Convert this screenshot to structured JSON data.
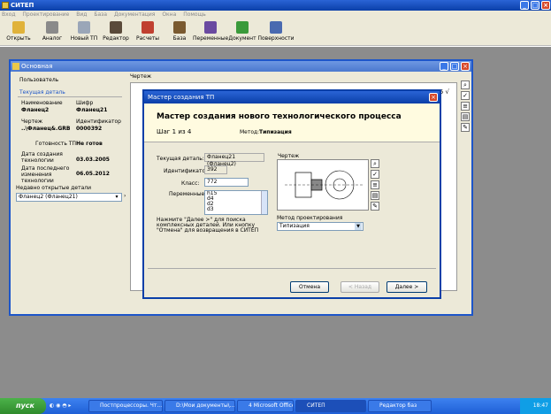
{
  "app": {
    "title": "СИТЕП"
  },
  "menu": [
    "Вход",
    "Проектирование",
    "Вид",
    "База",
    "Документация",
    "Окна",
    "Помощь"
  ],
  "toolbar": [
    {
      "label": "Открыть",
      "icon": "folder-open-icon",
      "color": "#e0b23a"
    },
    {
      "label": "Аналог",
      "icon": "hammer-icon",
      "color": "#8a8a8a"
    },
    {
      "label": "Новый ТП",
      "icon": "new-process-icon",
      "color": "#9aa6b8"
    },
    {
      "label": "Редактор",
      "icon": "editor-icon",
      "color": "#5a4a3a"
    },
    {
      "label": "Расчеты",
      "icon": "calculator-icon",
      "color": "#c04030"
    },
    {
      "label": "База",
      "icon": "database-icon",
      "color": "#7a5a30"
    },
    {
      "label": "Переменные",
      "icon": "function-icon",
      "color": "#6a4aa0"
    },
    {
      "label": "Документ",
      "icon": "document-icon",
      "color": "#3a9a3a"
    },
    {
      "label": "Поверхности",
      "icon": "surfaces-icon",
      "color": "#4a6ab0"
    }
  ],
  "main_window": {
    "title": "Основная",
    "user_label": "Пользователь",
    "current_part_header": "Текущая деталь",
    "name_label": "Наименование",
    "name_value": "Фланец2",
    "cipher_label": "Шифр",
    "cipher_value": "Фланец21",
    "drawing_label": "Чертеж",
    "drawing_value": "..\\Фланец&.GRB",
    "id_label": "Идентификатор",
    "id_value": "0000392",
    "readiness_label": "Готовность ТП",
    "readiness_value": "Не готов",
    "created_label": "Дата создания технологии",
    "created_value": "03.03.2005",
    "modified_label": "Дата последнего изменения технологии",
    "modified_value": "06.05.2012",
    "recent_label": "Недавно открытые детали",
    "recent_value": "Фланец2 (Фланец21)",
    "canvas_label": "Чертеж",
    "canvas_value": "2,5 √"
  },
  "wizard": {
    "window_title": "Мастер создания ТП",
    "heading": "Мастер создания нового технологического процесса",
    "step": "Шаг 1 из 4",
    "method_label": "Метод:",
    "method_value": "Типизация",
    "current_part_label": "Текущая деталь:",
    "current_part_value": "Фланец21 (Фланец2)",
    "id_label": "Идентификатор:",
    "id_value": "392",
    "class_label": "Класс:",
    "class_value": "772",
    "variables_label": "Переменные:",
    "variables": [
      "h15",
      "d4",
      "d2",
      "d3"
    ],
    "drawing_label": "Чертеж",
    "hint": "Нажмите \"Далее >\" для поиска комплексных деталей. Или кнопку \"Отмена\" для возвращения в СИТЕП",
    "design_method_label": "Метод проектирования",
    "design_method_value": "Типизация",
    "cancel": "Отмена",
    "back": "< Назад",
    "next": "Далее >"
  },
  "taskbar": {
    "start": "пуск",
    "items": [
      "Постпроцессоры. Чт...",
      "D:\\Мои документы\\...",
      "4 Microsoft Office ...",
      "СИТЕП",
      "Редактор баз"
    ],
    "clock": "18:47"
  }
}
